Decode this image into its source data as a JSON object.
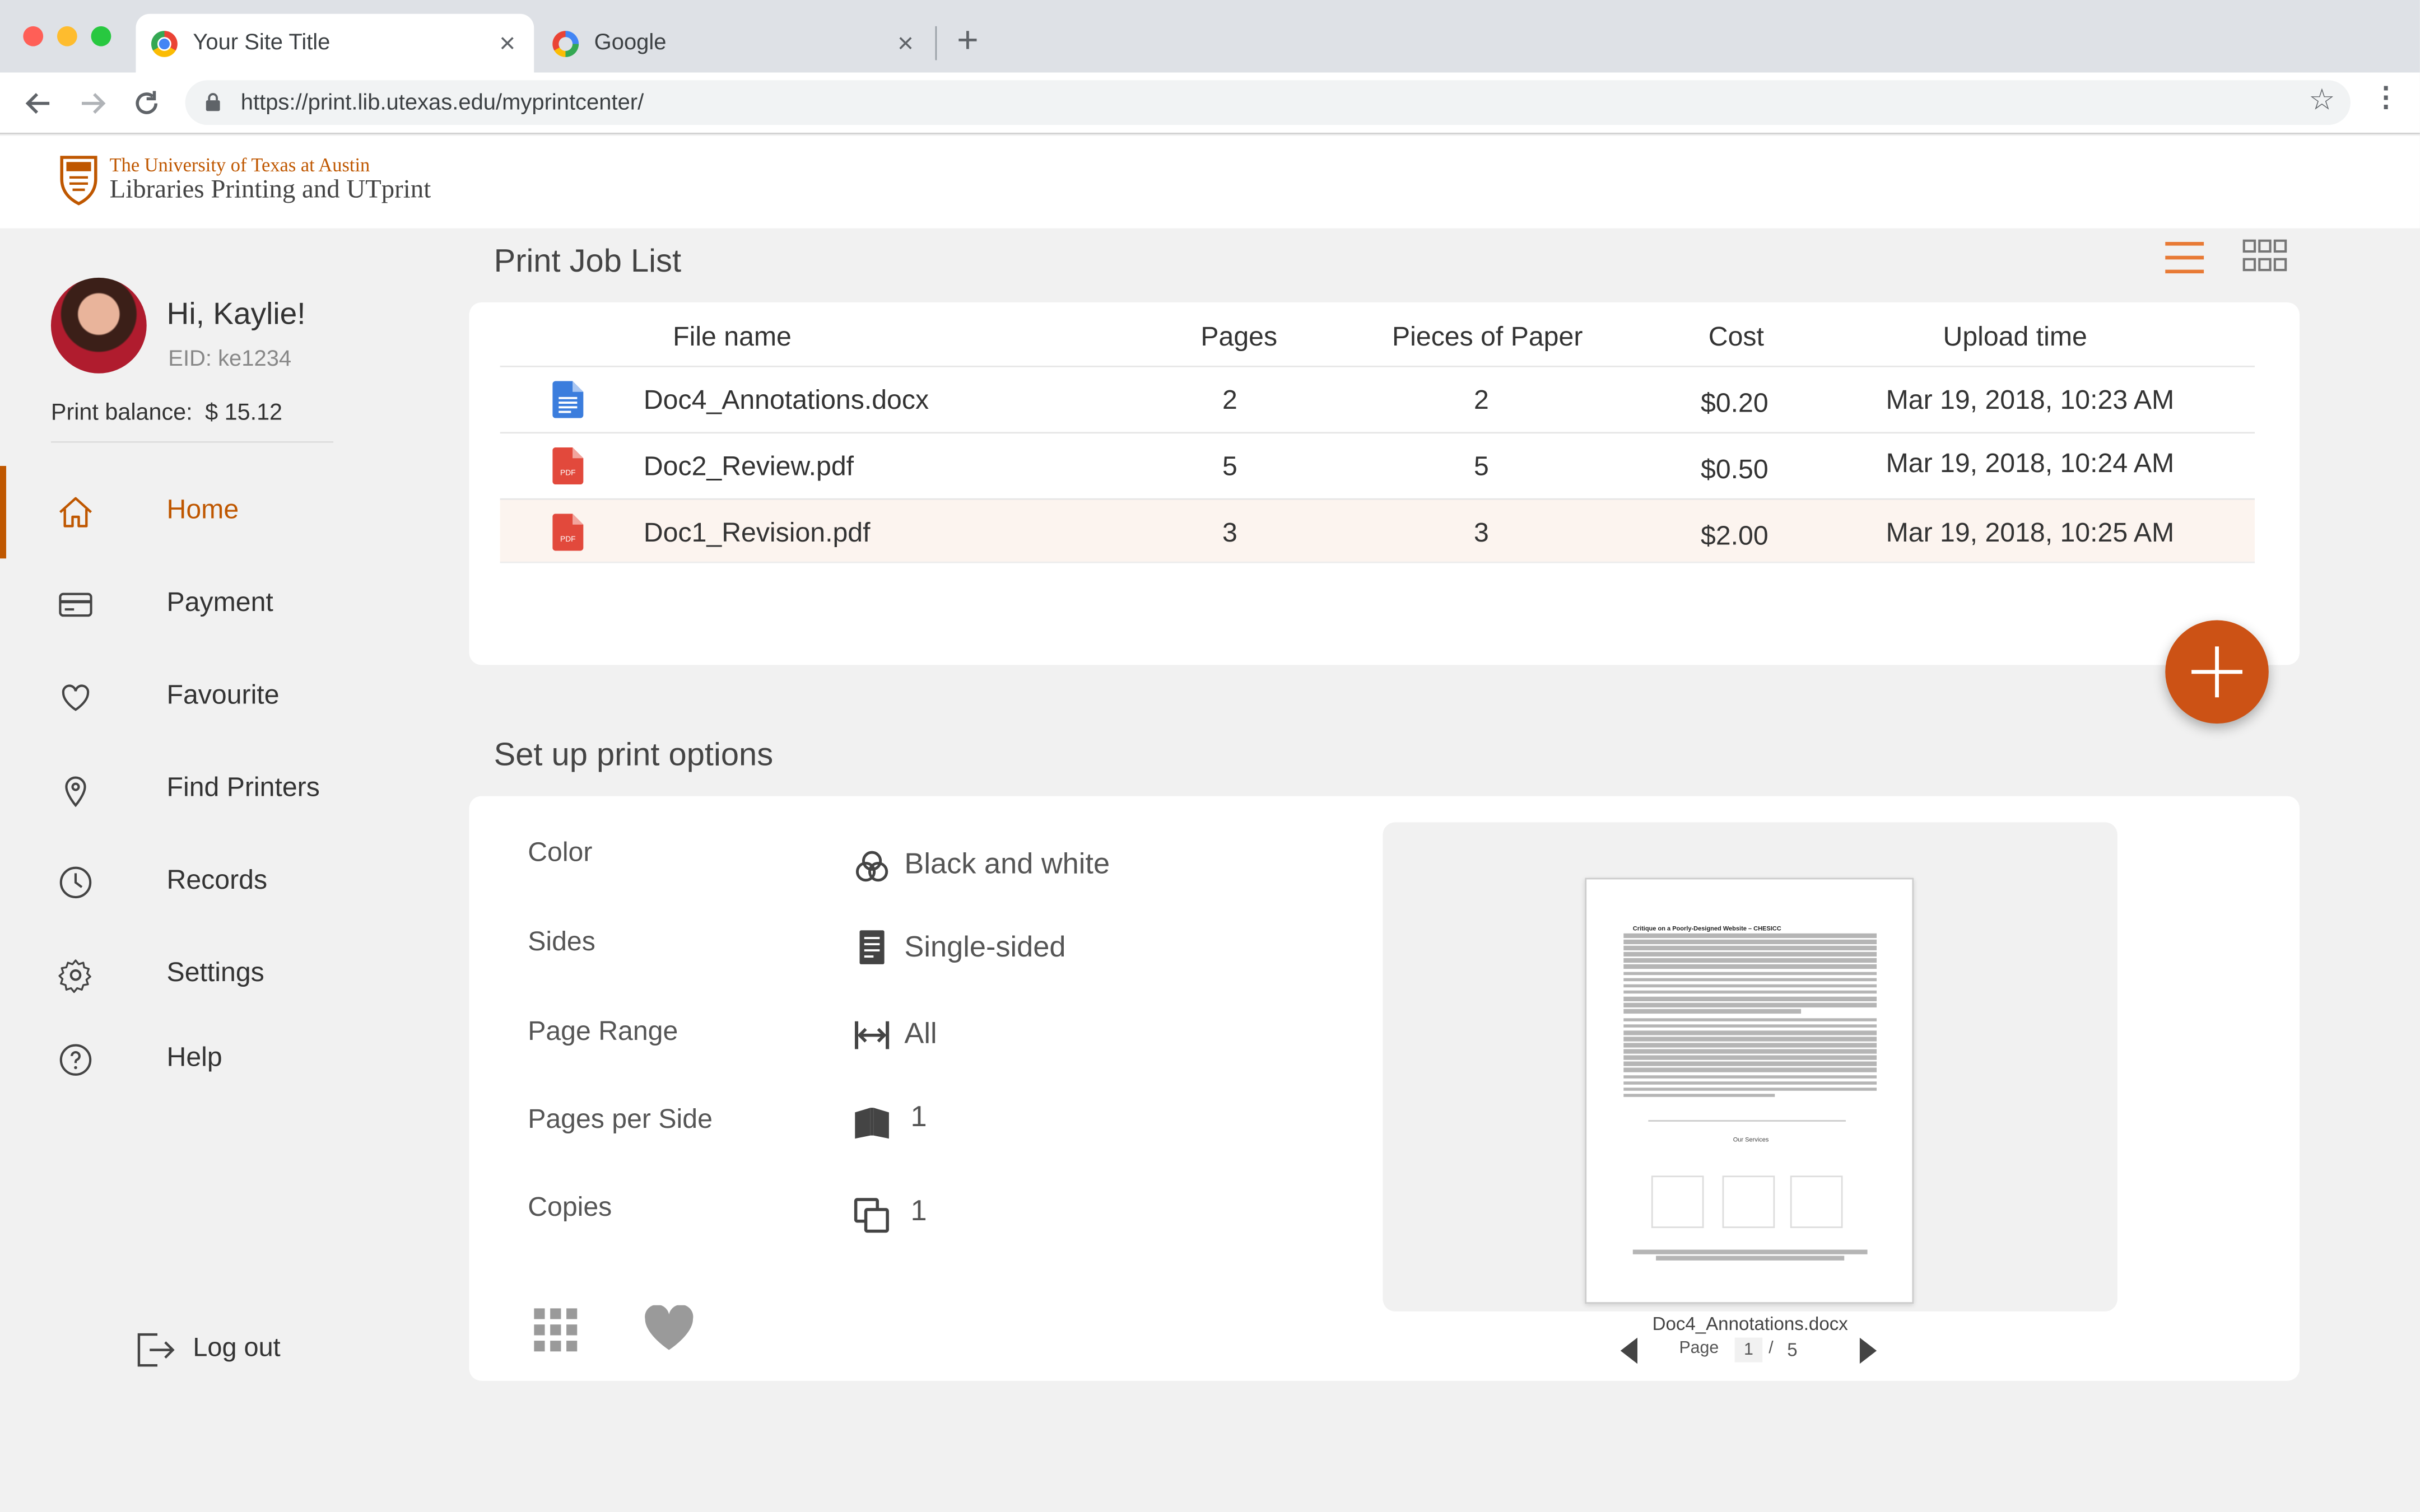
{
  "browser": {
    "tabs": [
      {
        "title": "Your Site Title",
        "active": true
      },
      {
        "title": "Google",
        "active": false
      }
    ],
    "url": "https://print.lib.utexas.edu/myprintcenter/"
  },
  "header": {
    "university": "The University of Texas at Austin",
    "site": "Libraries Printing and UTprint"
  },
  "user": {
    "greeting": "Hi, Kaylie!",
    "eid": "EID: ke1234",
    "balance_label": "Print balance:",
    "balance": "$ 15.12"
  },
  "nav": [
    {
      "label": "Home",
      "icon": "home-icon",
      "active": true
    },
    {
      "label": "Payment",
      "icon": "credit-card-icon"
    },
    {
      "label": "Favourite",
      "icon": "heart-icon"
    },
    {
      "label": "Find Printers",
      "icon": "map-pin-icon"
    },
    {
      "label": "Records",
      "icon": "clock-icon"
    },
    {
      "label": "Settings",
      "icon": "gear-icon"
    },
    {
      "label": "Help",
      "icon": "help-icon"
    }
  ],
  "logout": "Log out",
  "jobs": {
    "title": "Print Job List",
    "columns": [
      "File name",
      "Pages",
      "Pieces of Paper",
      "Cost",
      "Upload time"
    ],
    "rows": [
      {
        "type": "docx",
        "name": "Doc4_Annotations.docx",
        "pages": "2",
        "pieces": "2",
        "cost": "$0.20",
        "time": "Mar 19, 2018, 10:23 AM"
      },
      {
        "type": "pdf",
        "name": "Doc2_Review.pdf",
        "pages": "5",
        "pieces": "5",
        "cost": "$0.50",
        "time": "Mar 19, 2018, 10:24 AM"
      },
      {
        "type": "pdf",
        "name": "Doc1_Revision.pdf",
        "pages": "3",
        "pieces": "3",
        "cost": "$2.00",
        "time": "Mar 19, 2018, 10:25 AM",
        "selected": true
      }
    ],
    "pdf_badge": "PDF"
  },
  "options": {
    "title": "Set up print options",
    "items": [
      {
        "label": "Color",
        "value": "Black and white",
        "icon": "color-palette-icon"
      },
      {
        "label": "Sides",
        "value": "Single-sided",
        "icon": "single-page-icon"
      },
      {
        "label": "Page Range",
        "value": "All",
        "icon": "range-arrows-icon"
      },
      {
        "label": "Pages per Side",
        "value": "1",
        "icon": "open-book-icon"
      },
      {
        "label": "Copies",
        "value": "1",
        "icon": "copies-icon"
      }
    ]
  },
  "preview": {
    "doc_heading": "Critique on a Poorly-Designed Website – CHESICC",
    "section_heading": "Our Services",
    "filename": "Doc4_Annotations.docx",
    "page_label": "Page",
    "page_current": "1",
    "page_sep": "/",
    "page_total": "5"
  },
  "colors": {
    "accent": "#bf5700",
    "fab": "#cc5215"
  }
}
